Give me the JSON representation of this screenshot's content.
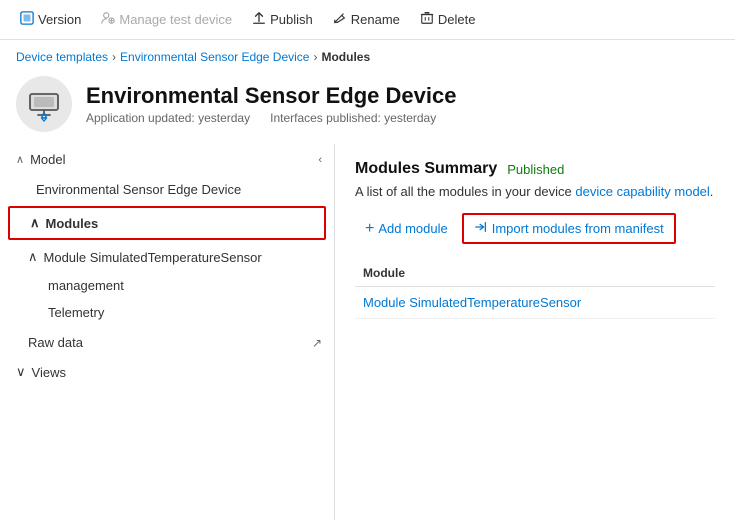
{
  "toolbar": {
    "items": [
      {
        "id": "version",
        "label": "Version",
        "icon": "🔲",
        "disabled": false
      },
      {
        "id": "manage-test-device",
        "label": "Manage test device",
        "icon": "⚗",
        "disabled": true
      },
      {
        "id": "publish",
        "label": "Publish",
        "icon": "↑",
        "disabled": false
      },
      {
        "id": "rename",
        "label": "Rename",
        "icon": "✏",
        "disabled": false
      },
      {
        "id": "delete",
        "label": "Delete",
        "icon": "🗑",
        "disabled": false
      }
    ]
  },
  "breadcrumb": {
    "items": [
      {
        "label": "Device templates",
        "link": true
      },
      {
        "label": "Environmental Sensor Edge Device",
        "link": true
      },
      {
        "label": "Modules",
        "link": false
      }
    ]
  },
  "device": {
    "name": "Environmental Sensor Edge Device",
    "meta_updated": "Application updated: yesterday",
    "meta_published": "Interfaces published: yesterday"
  },
  "left_nav": {
    "model_section": "Model",
    "model_item": "Environmental Sensor Edge Device",
    "modules_section": "Modules",
    "module_simulated": "Module SimulatedTemperatureSensor",
    "management_item": "management",
    "telemetry_item": "Telemetry",
    "raw_data_item": "Raw data",
    "views_section": "Views"
  },
  "right_panel": {
    "summary_title": "Modules Summary",
    "published_label": "Published",
    "description": "A list of all the modules in your device capability model.",
    "capability_link": "device capability model",
    "add_module_label": "Add module",
    "import_label": "Import modules from manifest",
    "table_header": "Module",
    "module_row": "Module SimulatedTemperatureSensor"
  }
}
